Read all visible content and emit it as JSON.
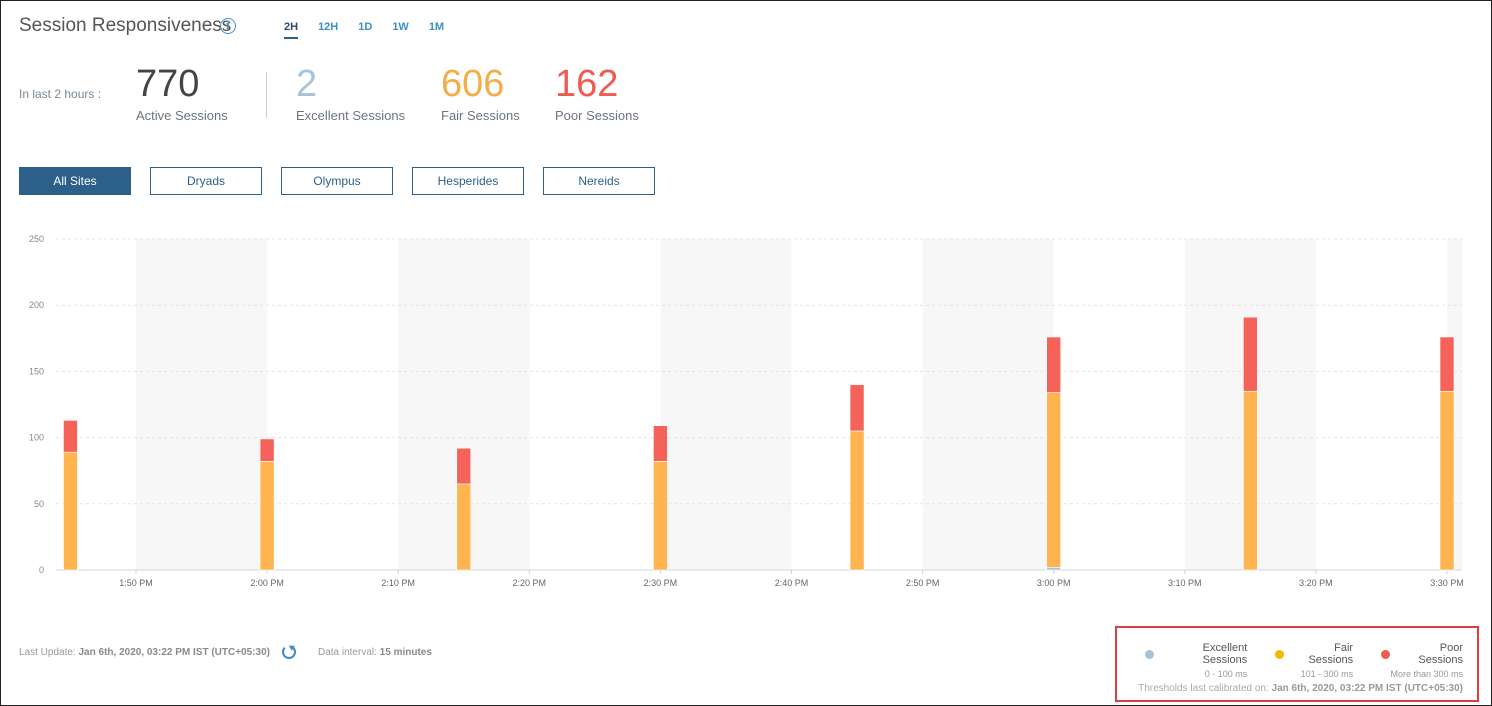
{
  "header": {
    "title": "Session Responsiveness",
    "time_ranges": [
      "2H",
      "12H",
      "1D",
      "1W",
      "1M"
    ],
    "active_range": "2H"
  },
  "kpis": {
    "label": "In last 2 hours :",
    "active": {
      "value": "770",
      "label": "Active Sessions",
      "color": "#444444"
    },
    "excellent": {
      "value": "2",
      "label": "Excellent Sessions",
      "color": "#a7c4d8"
    },
    "fair": {
      "value": "606",
      "label": "Fair Sessions",
      "color": "#f5ad4a"
    },
    "poor": {
      "value": "162",
      "label": "Poor Sessions",
      "color": "#ef5b50"
    }
  },
  "filters": {
    "items": [
      "All Sites",
      "Dryads",
      "Olympus",
      "Hesperides",
      "Nereids"
    ],
    "active": "All Sites"
  },
  "chart_data": {
    "type": "bar",
    "stacked": true,
    "ylim": [
      0,
      250
    ],
    "yticks": [
      0,
      50,
      100,
      150,
      200,
      250
    ],
    "x_tick_labels": [
      "1:50 PM",
      "2:00 PM",
      "2:10 PM",
      "2:20 PM",
      "2:30 PM",
      "2:40 PM",
      "2:50 PM",
      "3:00 PM",
      "3:10 PM",
      "3:20 PM",
      "3:30 PM"
    ],
    "categories": [
      "1:45 PM",
      "2:00 PM",
      "2:15 PM",
      "2:30 PM",
      "2:45 PM",
      "3:00 PM",
      "3:15 PM",
      "3:30 PM"
    ],
    "series": [
      {
        "name": "Excellent Sessions",
        "color": "#a7c4d8",
        "values": [
          0,
          0,
          0,
          0,
          0,
          2,
          0,
          0
        ]
      },
      {
        "name": "Fair Sessions",
        "color": "#ffb450",
        "values": [
          89,
          82,
          65,
          82,
          105,
          132,
          135,
          135
        ]
      },
      {
        "name": "Poor Sessions",
        "color": "#f4625a",
        "values": [
          24,
          17,
          27,
          27,
          35,
          42,
          56,
          41
        ]
      }
    ],
    "grid": true
  },
  "footer": {
    "last_update_label": "Last Update:",
    "last_update_value": "Jan 6th, 2020, 03:22 PM IST (UTC+05:30)",
    "interval_label": "Data interval:",
    "interval_value": "15 minutes"
  },
  "legend": {
    "items": [
      {
        "name": "Excellent Sessions",
        "range": "0 - 100 ms",
        "color": "#a7c4d8"
      },
      {
        "name": "Fair Sessions",
        "range": "101 - 300 ms",
        "color": "#f5b800"
      },
      {
        "name": "Poor Sessions",
        "range": "More than 300 ms",
        "color": "#ef5b50"
      }
    ],
    "calibrated_label": "Thresholds last calibrated on:",
    "calibrated_value": "Jan 6th, 2020, 03:22 PM IST (UTC+05:30)"
  }
}
